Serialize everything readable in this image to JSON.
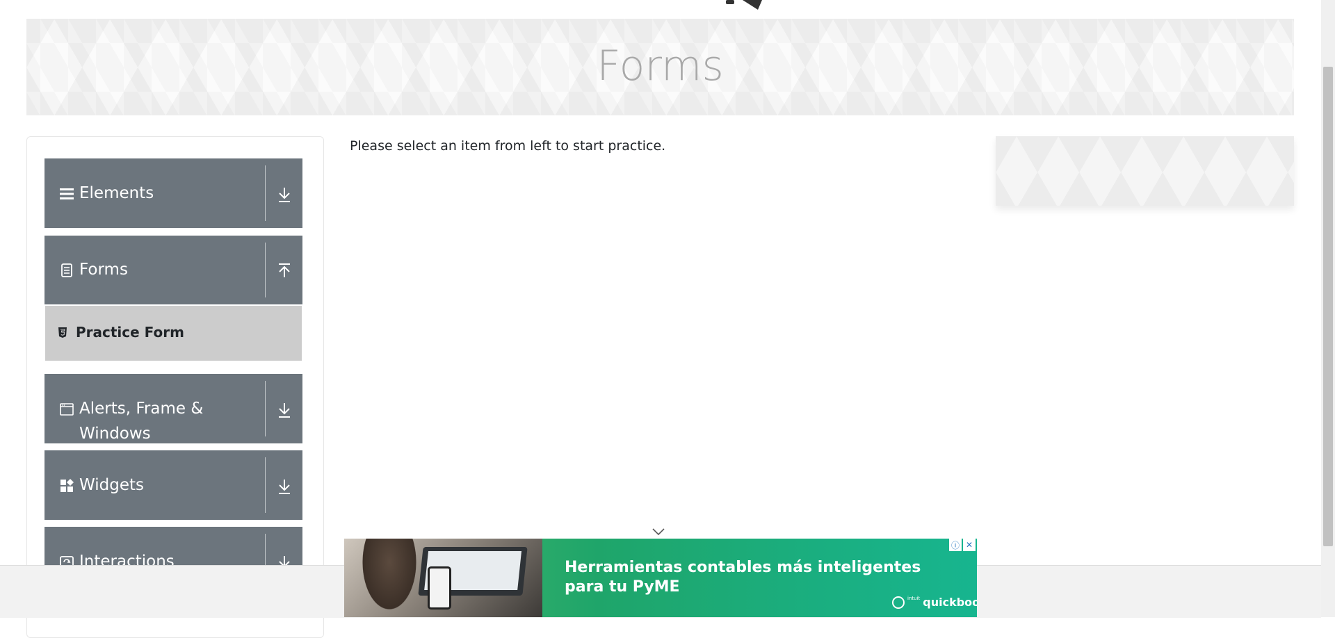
{
  "header": {
    "page_title": "Forms"
  },
  "sidebar": {
    "groups": [
      {
        "label": "Elements",
        "icon": "list-icon",
        "expanded": false,
        "arrow": "download-arrow-icon"
      },
      {
        "label": "Forms",
        "icon": "document-icon",
        "expanded": true,
        "arrow": "upload-arrow-icon",
        "items": [
          {
            "label": "Practice Form",
            "icon": "html5-icon"
          }
        ]
      },
      {
        "label": "Alerts, Frame &",
        "label_line2": "Windows",
        "icon": "window-icon",
        "expanded": false,
        "arrow": "download-arrow-icon"
      },
      {
        "label": "Widgets",
        "icon": "widgets-icon",
        "expanded": false,
        "arrow": "download-arrow-icon"
      },
      {
        "label": "Interactions",
        "icon": "interactions-icon",
        "expanded": false,
        "arrow": "download-arrow-icon"
      }
    ]
  },
  "main": {
    "intro_text": "Please select an item from left to start practice."
  },
  "ad": {
    "headline": "Herramientas contables más inteligentes para tu PyME",
    "brand_prefix": "intuit",
    "brand": "quickbooks.",
    "info_icon": "info-icon",
    "close_icon": "close-icon",
    "collapse_icon": "chevron-down-icon"
  },
  "colors": {
    "menu_header_bg": "#6c757d",
    "menu_item_active_bg": "#cccccc",
    "title_color": "#a9a9a9",
    "ad_green": "#1fa56a"
  }
}
